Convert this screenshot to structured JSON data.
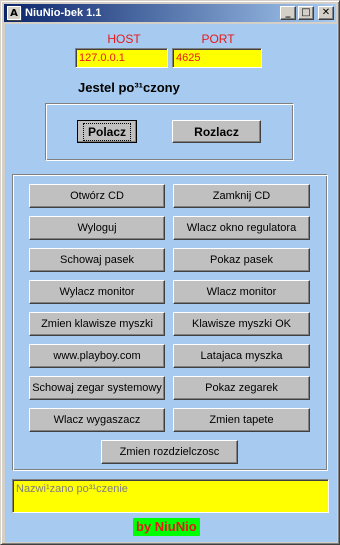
{
  "window": {
    "title": "NiuNio-bek 1.1",
    "icon_glyph": "A",
    "controls": {
      "minimize": "_",
      "maximize": "□",
      "close": "✕"
    }
  },
  "connection": {
    "host_label": "HOST",
    "port_label": "PORT",
    "host_value": "127.0.0.1",
    "port_value": "4625",
    "status_text": "Jestel po³¹czony"
  },
  "connect_buttons": {
    "connect": "Polacz",
    "disconnect": "Rozlacz"
  },
  "actions": {
    "open_cd": "Otwórz CD",
    "close_cd": "Zamknij CD",
    "logout": "Wyloguj",
    "volume_window": "Wlacz okno regulatora",
    "hide_taskbar": "Schowaj pasek",
    "show_taskbar": "Pokaz pasek",
    "monitor_off": "Wylacz monitor",
    "monitor_on": "Wlacz monitor",
    "swap_mouse": "Zmien klawisze myszki",
    "mouse_ok": "Klawisze myszki OK",
    "website": "www.playboy.com",
    "flying_mouse": "Latajaca myszka",
    "hide_clock": "Schowaj zegar systemowy",
    "show_clock": "Pokaz zegarek",
    "screensaver": "Wlacz wygaszacz",
    "wallpaper": "Zmien tapete",
    "resolution": "Zmien rozdzielczosc"
  },
  "message": "Nazwi¹zano po³¹czenie",
  "signature": "by NiuNio",
  "colors": {
    "client_bg": "#a6caf0",
    "field_bg": "#ffff00",
    "label_red": "#e8181c",
    "signature_bg": "#00ff00"
  }
}
